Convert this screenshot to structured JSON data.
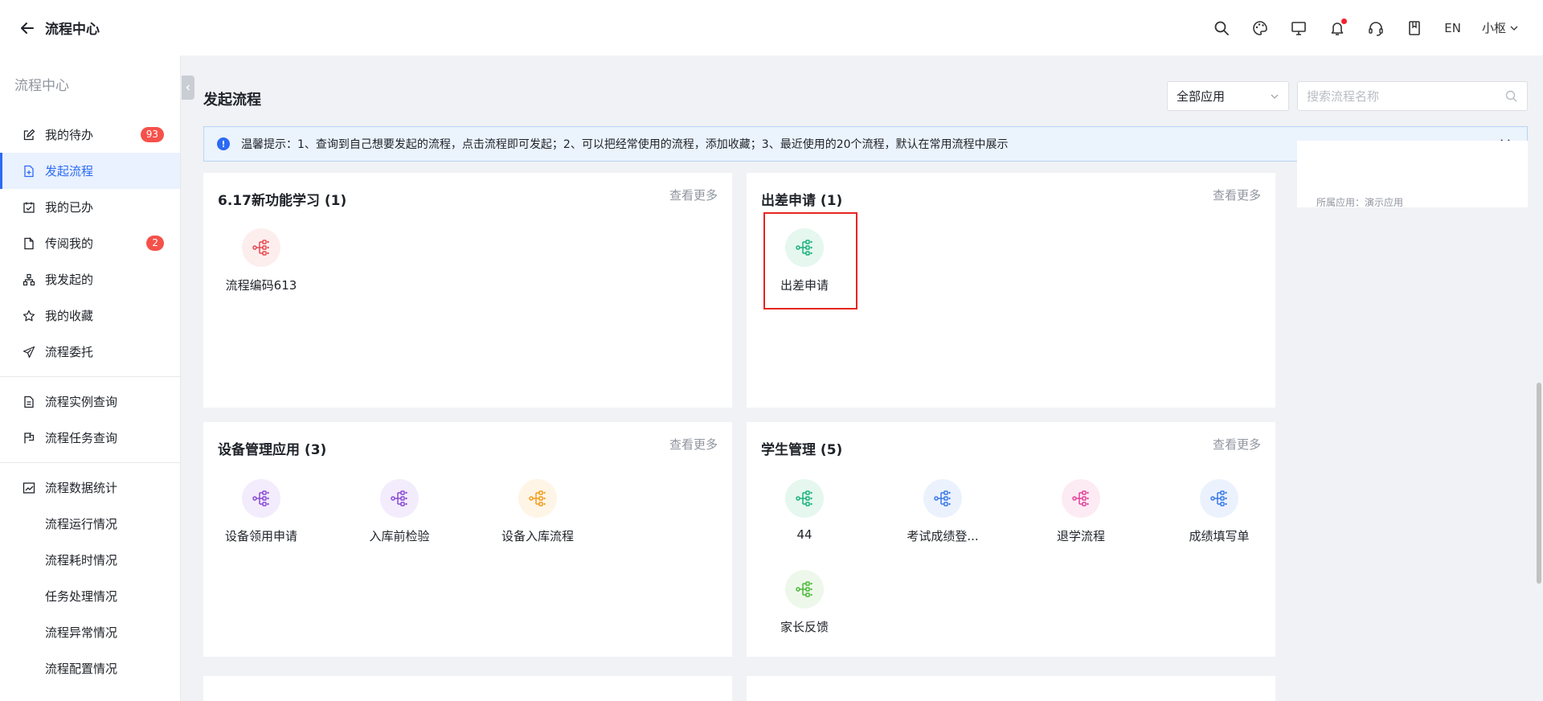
{
  "header": {
    "title": "流程中心",
    "lang": "EN",
    "user": "小枢"
  },
  "sidebar": {
    "title": "流程中心",
    "items": [
      {
        "label": "我的待办",
        "badge": "93"
      },
      {
        "label": "发起流程"
      },
      {
        "label": "我的已办"
      },
      {
        "label": "传阅我的",
        "badge": "2"
      },
      {
        "label": "我发起的"
      },
      {
        "label": "我的收藏"
      },
      {
        "label": "流程委托"
      }
    ],
    "query_items": [
      {
        "label": "流程实例查询"
      },
      {
        "label": "流程任务查询"
      }
    ],
    "stats": {
      "label": "流程数据统计",
      "children": [
        "流程运行情况",
        "流程耗时情况",
        "任务处理情况",
        "流程异常情况",
        "流程配置情况"
      ]
    }
  },
  "main": {
    "title": "发起流程",
    "app_select": "全部应用",
    "search_placeholder": "搜索流程名称",
    "tip": "温馨提示：1、查询到自己想要发起的流程，点击流程即可发起；2、可以把经常使用的流程，添加收藏；3、最近使用的20个流程，默认在常用流程中展示",
    "side_panel_text": "所属应用：演示应用",
    "more_label": "查看更多",
    "cards": [
      {
        "title": "6.17新功能学习 (1)",
        "flows": [
          {
            "label": "流程编码613",
            "color": "#e8484e",
            "bg": "#fdeeee"
          }
        ]
      },
      {
        "title": "出差申请 (1)",
        "flows": [
          {
            "label": "出差申请",
            "color": "#1bb27d",
            "bg": "#e5f7ef"
          }
        ]
      },
      {
        "title": "设备管理应用 (3)",
        "flows": [
          {
            "label": "设备领用申请",
            "color": "#8a4bd6",
            "bg": "#f3ecfc"
          },
          {
            "label": "入库前检验",
            "color": "#8a4bd6",
            "bg": "#f3ecfc"
          },
          {
            "label": "设备入库流程",
            "color": "#f29b1d",
            "bg": "#fef5e6"
          }
        ]
      },
      {
        "title": "学生管理 (5)",
        "flows": [
          {
            "label": "44",
            "color": "#1bb27d",
            "bg": "#e5f7ef"
          },
          {
            "label": "考试成绩登...",
            "color": "#3b7ae8",
            "bg": "#ebf2fd"
          },
          {
            "label": "退学流程",
            "color": "#e0449a",
            "bg": "#fdebf4"
          },
          {
            "label": "成绩填写单",
            "color": "#3b7ae8",
            "bg": "#ebf2fd"
          },
          {
            "label": "家长反馈",
            "color": "#4cb93a",
            "bg": "#edf8ea"
          }
        ]
      }
    ]
  }
}
